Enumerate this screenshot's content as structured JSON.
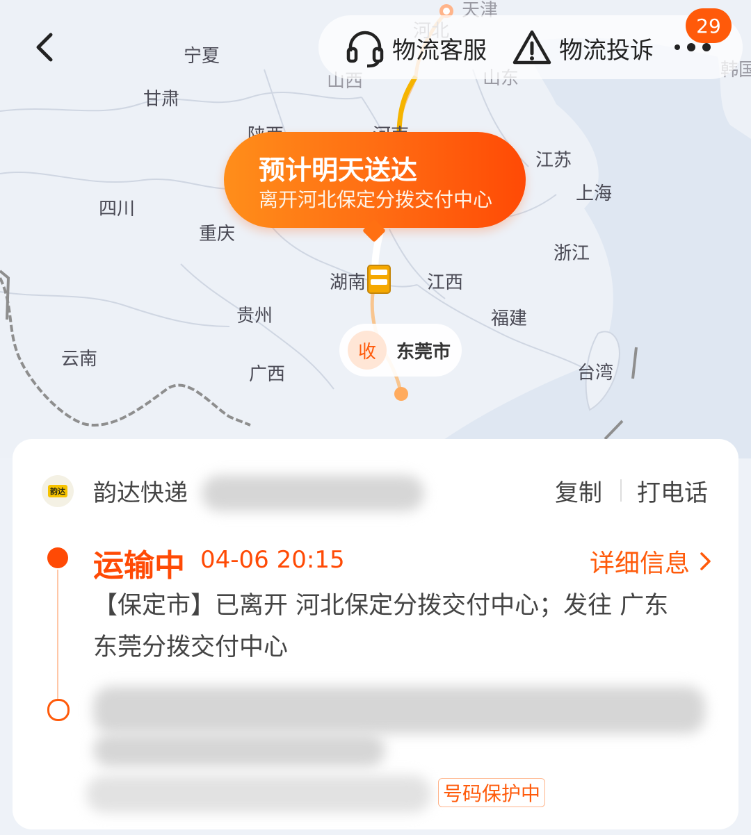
{
  "top_bar": {
    "service_label": "物流客服",
    "complaint_label": "物流投诉",
    "badge_count": "29"
  },
  "map": {
    "provinces": [
      {
        "key": "tianjin",
        "label": "天津"
      },
      {
        "key": "hebei",
        "label": "河北"
      },
      {
        "key": "ningxia",
        "label": "宁夏"
      },
      {
        "key": "shanxi",
        "label": "山西"
      },
      {
        "key": "shandong",
        "label": "山东"
      },
      {
        "key": "korea",
        "label": "韩国"
      },
      {
        "key": "gansu",
        "label": "甘肃"
      },
      {
        "key": "shaanxi",
        "label": "陕西"
      },
      {
        "key": "henan",
        "label": "河南"
      },
      {
        "key": "jiangsu",
        "label": "江苏"
      },
      {
        "key": "sichuan",
        "label": "四川"
      },
      {
        "key": "shanghai",
        "label": "上海"
      },
      {
        "key": "chongqing",
        "label": "重庆"
      },
      {
        "key": "zhejiang",
        "label": "浙江"
      },
      {
        "key": "hunan",
        "label": "湖南"
      },
      {
        "key": "jiangxi",
        "label": "江西"
      },
      {
        "key": "guizhou",
        "label": "贵州"
      },
      {
        "key": "fujian",
        "label": "福建"
      },
      {
        "key": "yunnan",
        "label": "云南"
      },
      {
        "key": "guangxi",
        "label": "广西"
      },
      {
        "key": "taiwan",
        "label": "台湾"
      }
    ],
    "eta_title": "预计明天送达",
    "eta_subtitle": "离开河北保定分拨交付中心",
    "destination_tag": "收",
    "destination_city": "东莞市",
    "route_color": "#f5a623",
    "accent_color": "#ff5a0a"
  },
  "card": {
    "carrier_logo_text": "韵达",
    "carrier_name": "韵达快递",
    "copy_label": "复制",
    "call_label": "打电话",
    "latest_event": {
      "status": "运输中",
      "time": "04-06 20:15",
      "description": "【保定市】已离开 河北保定分拨交付中心；发往 广东东莞分拨交付中心"
    },
    "detail_label": "详细信息",
    "privacy_label": "号码保护中"
  }
}
